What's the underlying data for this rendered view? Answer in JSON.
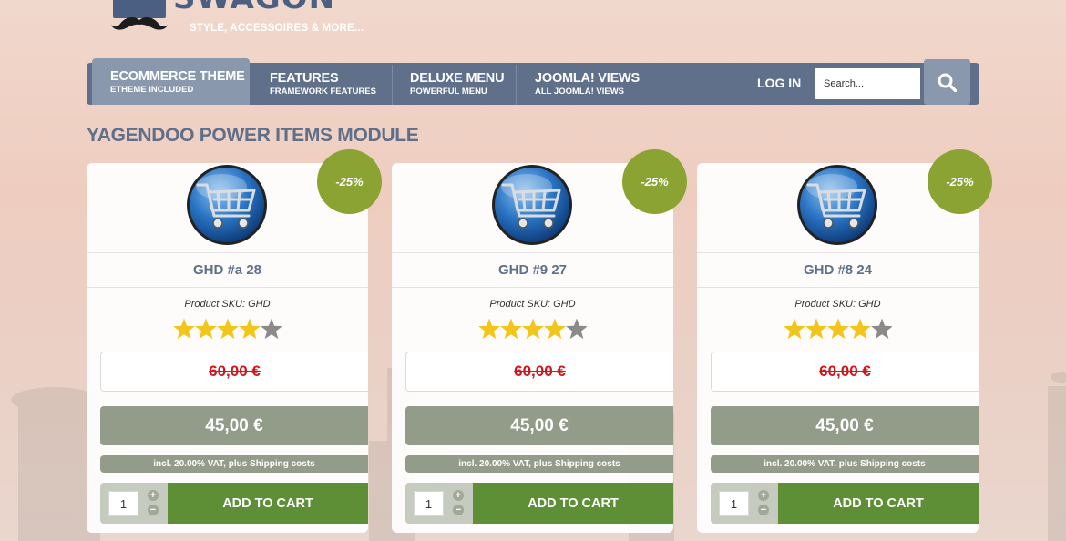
{
  "header": {
    "logo_text": "SWAGON",
    "tagline": "STYLE, ACCESSOIRES & MORE..."
  },
  "nav": {
    "items": [
      {
        "title": "ECOMMERCE THEME",
        "subtitle": "ETHEME INCLUDED",
        "active": true
      },
      {
        "title": "FEATURES",
        "subtitle": "FRAMEWORK FEATURES",
        "active": false
      },
      {
        "title": "DELUXE MENU",
        "subtitle": "POWERFUL MENU",
        "active": false
      },
      {
        "title": "JOOMLA! VIEWS",
        "subtitle": "ALL JOOMLA! VIEWS",
        "active": false
      }
    ],
    "login_label": "LOG IN",
    "search_placeholder": "Search..."
  },
  "module": {
    "title": "YAGENDOO POWER ITEMS MODULE"
  },
  "products": [
    {
      "name": "GHD #a 28",
      "sku": "Product SKU: GHD",
      "rating": 4,
      "rating_max": 5,
      "discount": "-25%",
      "old_price": "60,00 €",
      "price": "45,00 €",
      "vat_note": "incl. 20.00% VAT, plus Shipping costs",
      "quantity": "1",
      "cart_label": "ADD TO CART"
    },
    {
      "name": "GHD #9 27",
      "sku": "Product SKU: GHD",
      "rating": 4,
      "rating_max": 5,
      "discount": "-25%",
      "old_price": "60,00 €",
      "price": "45,00 €",
      "vat_note": "incl. 20.00% VAT, plus Shipping costs",
      "quantity": "1",
      "cart_label": "ADD TO CART"
    },
    {
      "name": "GHD #8 24",
      "sku": "Product SKU: GHD",
      "rating": 4,
      "rating_max": 5,
      "discount": "-25%",
      "old_price": "60,00 €",
      "price": "45,00 €",
      "vat_note": "incl. 20.00% VAT, plus Shipping costs",
      "quantity": "1",
      "cart_label": "ADD TO CART"
    }
  ],
  "colors": {
    "brand": "#61708a",
    "discount_badge": "#8aa333",
    "old_price": "#d0161b",
    "add_to_cart": "#5e8f37",
    "star_filled": "#f2c51b",
    "star_empty": "#8a8a8a"
  },
  "icons": {
    "product_image": "shopping-cart-icon",
    "search": "search-icon",
    "quantity_plus": "plus-icon",
    "quantity_minus": "minus-icon"
  }
}
